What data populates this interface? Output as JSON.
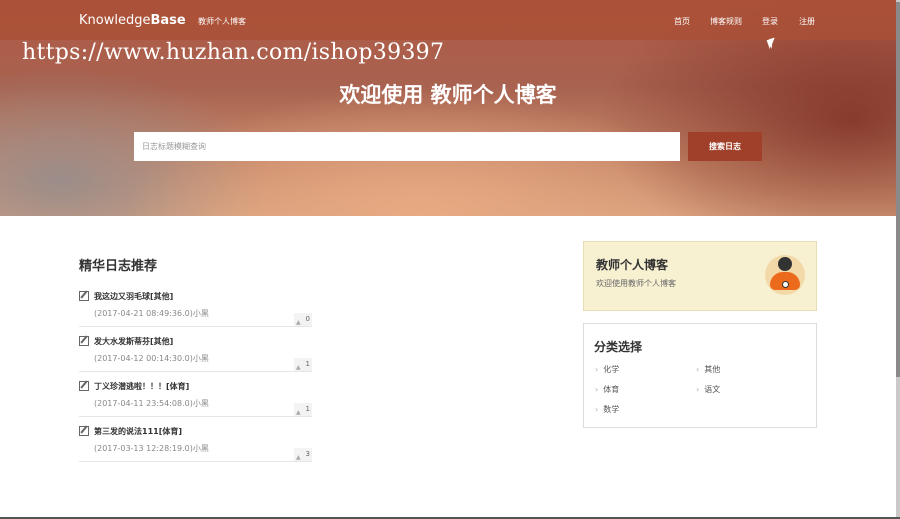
{
  "header": {
    "logo_light": "Knowledge",
    "logo_bold": "Base",
    "logo_sub": "教师个人博客",
    "nav": [
      "首页",
      "博客规则",
      "登录",
      "注册"
    ]
  },
  "watermark": "https://www.huzhan.com/ishop39397",
  "hero": {
    "title": "欢迎使用 教师个人博客",
    "search_placeholder": "日志标题模糊查询",
    "search_button": "搜索日志"
  },
  "main": {
    "section_title": "精华日志推荐",
    "posts": [
      {
        "title": "我这边又羽毛球[其他]",
        "meta": "(2017-04-21 08:49:36.0)小黑",
        "likes": "0"
      },
      {
        "title": "发大水发斯蒂芬[其他]",
        "meta": "(2017-04-12 00:14:30.0)小黑",
        "likes": "1"
      },
      {
        "title": "丁义珍潜逃啦！！！[体育]",
        "meta": "(2017-04-11 23:54:08.0)小黑",
        "likes": "1"
      },
      {
        "title": "第三发的说法111[体育]",
        "meta": "(2017-03-13 12:28:19.0)小黑",
        "likes": "3"
      }
    ]
  },
  "sidebar": {
    "profile_title": "教师个人博客",
    "profile_sub": "欢迎使用教师个人博客",
    "category_title": "分类选择",
    "categories": [
      "化学",
      "其他",
      "体育",
      "语文",
      "数学"
    ]
  },
  "colors": {
    "accent": "#a0402a",
    "topbar": "#aa5037",
    "avatar_orange": "#ec6a1c",
    "card_bg": "#f7f1d2"
  },
  "icons": {
    "post": "edit-icon",
    "like": "thumbs-up-icon",
    "category": "chevron-right-icon"
  }
}
